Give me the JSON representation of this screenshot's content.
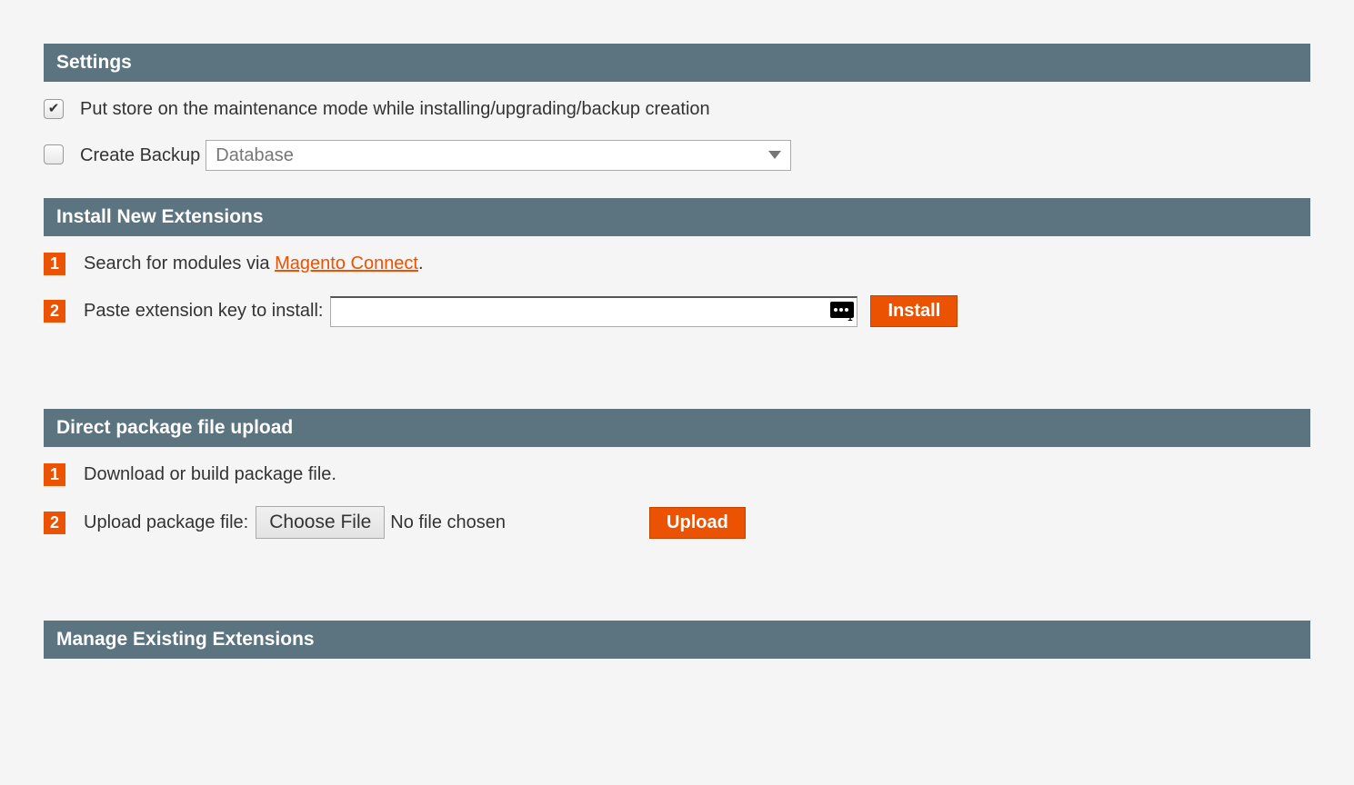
{
  "sections": {
    "settings": {
      "title": "Settings",
      "maintenance_label": "Put store on the maintenance mode while installing/upgrading/backup creation",
      "backup_label": "Create Backup",
      "backup_select_value": "Database"
    },
    "install": {
      "title": "Install New Extensions",
      "step1_prefix": "Search for modules via ",
      "step1_link": "Magento Connect",
      "step1_suffix": ".",
      "step2_label": "Paste extension key to install:",
      "install_button": "Install"
    },
    "upload": {
      "title": "Direct package file upload",
      "step1_label": "Download or build package file.",
      "step2_label": "Upload package file:",
      "choose_button": "Choose File",
      "file_status": "No file chosen",
      "upload_button": "Upload"
    },
    "manage": {
      "title": "Manage Existing Extensions"
    }
  },
  "badges": {
    "one": "1",
    "two": "2"
  }
}
